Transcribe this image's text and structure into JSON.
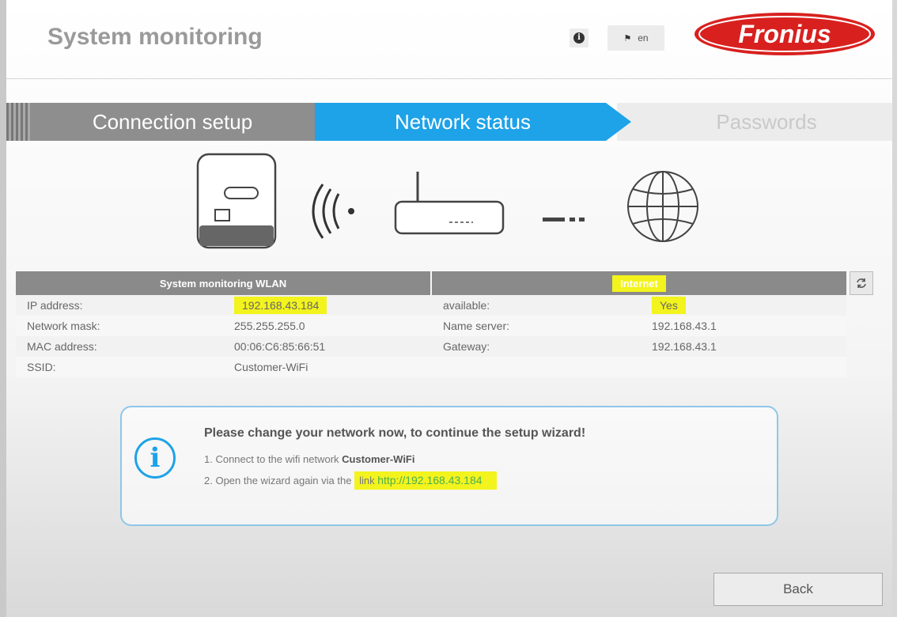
{
  "header": {
    "title": "System monitoring",
    "language": "en",
    "logo_text": "Fronius"
  },
  "tabs": [
    {
      "label": "Connection setup",
      "state": "done"
    },
    {
      "label": "Network status",
      "state": "active"
    },
    {
      "label": "Passwords",
      "state": "pending"
    }
  ],
  "diagram": {
    "nodes": [
      "inverter-icon",
      "wifi-signal-icon",
      "router-icon",
      "connection-dashes-icon",
      "globe-icon"
    ]
  },
  "table": {
    "wlan_header": "System monitoring WLAN",
    "internet_header": "Internet",
    "rows": [
      {
        "label": "IP address:",
        "value": "192.168.43.184",
        "label2": "available:",
        "value2": "Yes"
      },
      {
        "label": "Network mask:",
        "value": "255.255.255.0",
        "label2": "Name server:",
        "value2": "192.168.43.1"
      },
      {
        "label": "MAC address:",
        "value": "00:06:C6:85:66:51",
        "label2": "Gateway:",
        "value2": "192.168.43.1"
      },
      {
        "label": "SSID:",
        "value": "Customer-WiFi",
        "label2": "",
        "value2": ""
      }
    ]
  },
  "info": {
    "heading": "Please change your network now, to continue the setup wizard!",
    "step1_prefix": "1. Connect to the wifi network ",
    "step1_network": "Customer-WiFi",
    "step2_prefix": "2. Open the wizard again via the ",
    "step2_link_word": "link",
    "step2_link_url": "http://192.168.43.184"
  },
  "buttons": {
    "back": "Back"
  },
  "colors": {
    "accent": "#1ea2e8",
    "brand_red": "#d8211f",
    "highlight": "#f3f31e",
    "link_green": "#4caf50"
  }
}
